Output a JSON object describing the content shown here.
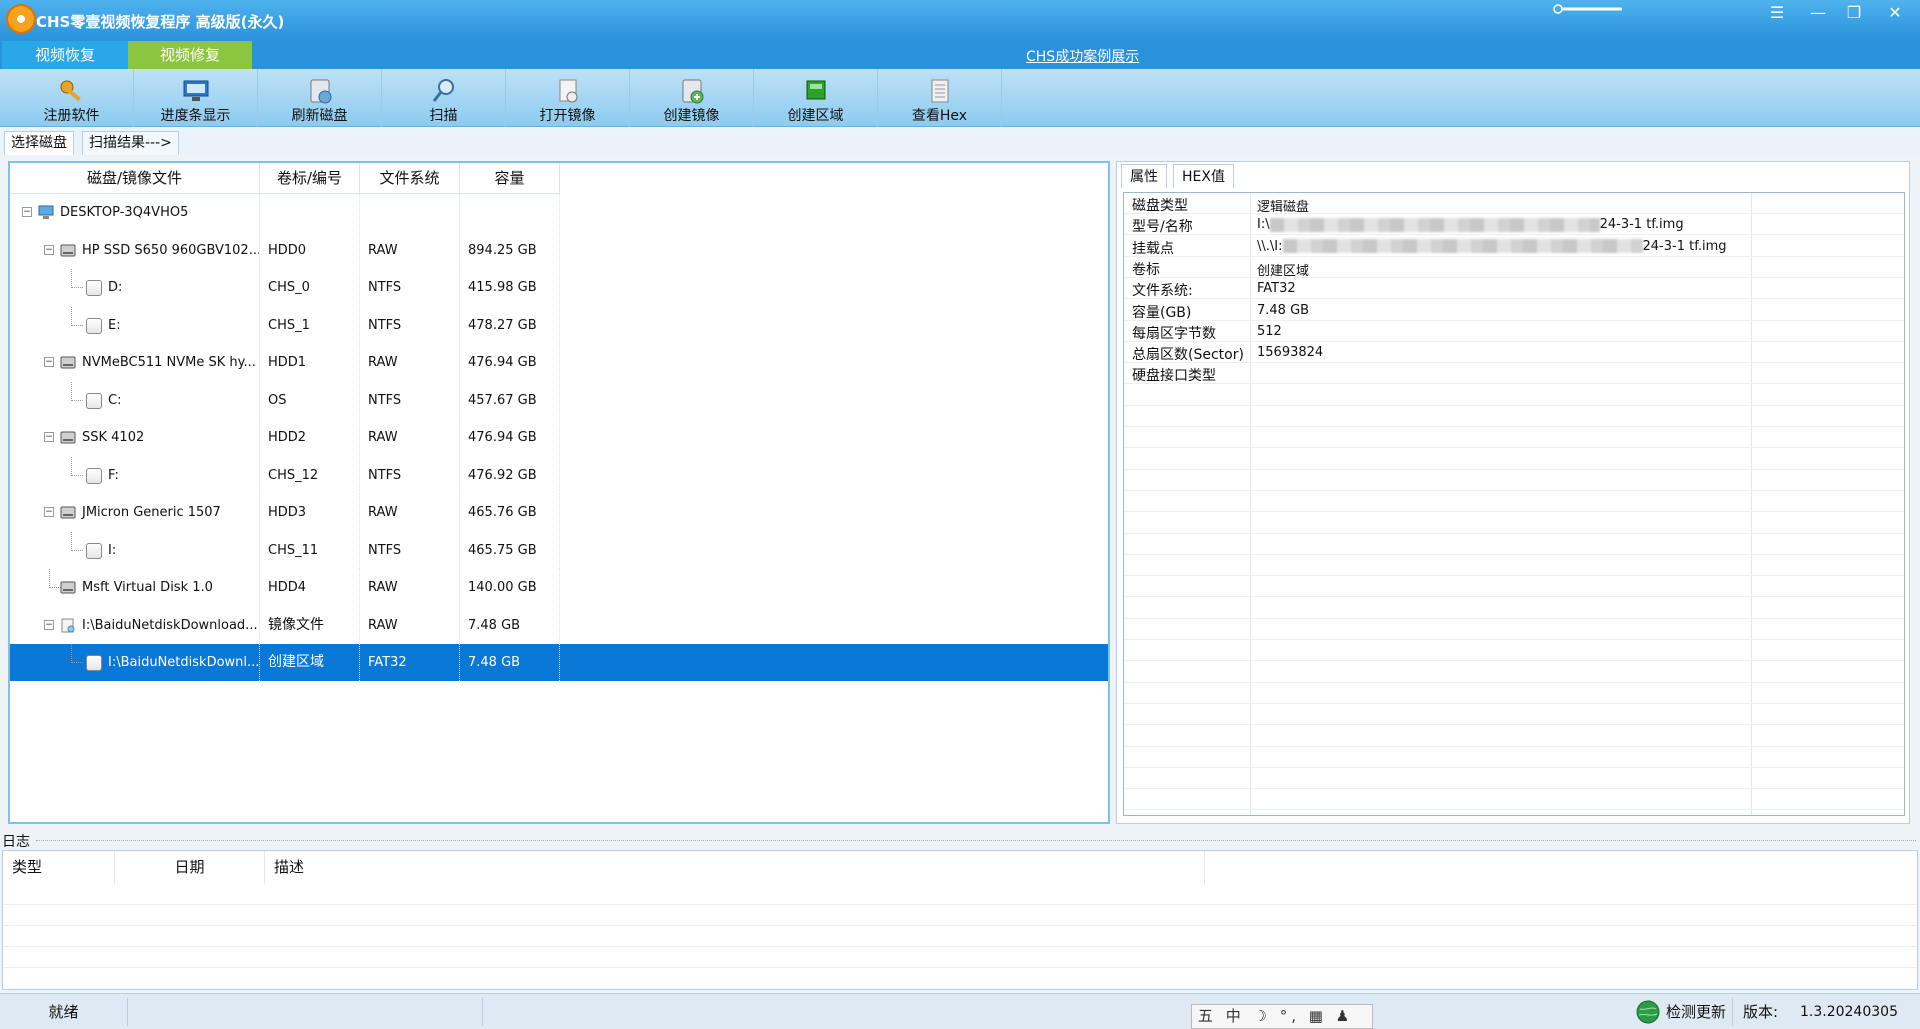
{
  "window": {
    "title": "CHS零壹视频恢复程序 高级版(永久)",
    "controls": [
      "☰",
      "—",
      "❐",
      "✕"
    ]
  },
  "mode_tabs": [
    "视频恢复",
    "视频修复"
  ],
  "success_link": "CHS成功案例展示",
  "toolbar": {
    "items": [
      {
        "label": "注册软件",
        "icon": "key-icon"
      },
      {
        "label": "进度条显示",
        "icon": "monitor-icon"
      },
      {
        "label": "刷新磁盘",
        "icon": "refresh-disk-icon"
      },
      {
        "label": "扫描",
        "icon": "magnifier-icon"
      },
      {
        "label": "打开镜像",
        "icon": "open-image-icon"
      },
      {
        "label": "创建镜像",
        "icon": "create-image-icon"
      },
      {
        "label": "创建区域",
        "icon": "create-region-icon"
      },
      {
        "label": "查看Hex",
        "icon": "hex-icon"
      }
    ]
  },
  "sub_tabs": [
    "选择磁盘",
    "扫描结果--->"
  ],
  "disk_table": {
    "headers": [
      "磁盘/镜像文件",
      "卷标/编号",
      "文件系统",
      "容量"
    ],
    "rows": [
      {
        "level": 0,
        "type": "computer",
        "name": "DESKTOP-3Q4VHO5",
        "label": "",
        "fs": "",
        "size": "",
        "expander": "−"
      },
      {
        "level": 1,
        "type": "disk",
        "name": "HP SSD S650 960GBV102...",
        "label": "HDD0",
        "fs": "RAW",
        "size": "894.25 GB",
        "expander": "−"
      },
      {
        "level": 2,
        "type": "volume",
        "name": "D:",
        "label": "CHS_0",
        "fs": "NTFS",
        "size": "415.98 GB"
      },
      {
        "level": 2,
        "type": "volume",
        "name": "E:",
        "label": "CHS_1",
        "fs": "NTFS",
        "size": "478.27 GB"
      },
      {
        "level": 1,
        "type": "disk",
        "name": "NVMeBC511 NVMe SK hy...",
        "label": "HDD1",
        "fs": "RAW",
        "size": "476.94 GB",
        "expander": "−"
      },
      {
        "level": 2,
        "type": "volume",
        "name": "C:",
        "label": "OS",
        "fs": "NTFS",
        "size": "457.67 GB"
      },
      {
        "level": 1,
        "type": "disk",
        "name": "SSK               4102",
        "label": "HDD2",
        "fs": "RAW",
        "size": "476.94 GB",
        "expander": "−"
      },
      {
        "level": 2,
        "type": "volume",
        "name": "F:",
        "label": "CHS_12",
        "fs": "NTFS",
        "size": "476.92 GB"
      },
      {
        "level": 1,
        "type": "disk",
        "name": "JMicron Generic        1507",
        "label": "HDD3",
        "fs": "RAW",
        "size": "465.76 GB",
        "expander": "−"
      },
      {
        "level": 2,
        "type": "volume",
        "name": "I:",
        "label": "CHS_11",
        "fs": "NTFS",
        "size": "465.75 GB"
      },
      {
        "level": 1,
        "type": "disk",
        "name": "Msft    Virtual Disk    1.0",
        "label": "HDD4",
        "fs": "RAW",
        "size": "140.00 GB"
      },
      {
        "level": 1,
        "type": "image",
        "name": "I:\\BaiduNetdiskDownload...",
        "label": "镜像文件",
        "fs": "RAW",
        "size": "7.48 GB",
        "expander": "−"
      },
      {
        "level": 2,
        "type": "volume",
        "name": "I:\\BaiduNetdiskDownl...",
        "label": "创建区域",
        "fs": "FAT32",
        "size": "7.48 GB",
        "selected": true
      }
    ]
  },
  "property_tabs": [
    "属性",
    "HEX值"
  ],
  "properties": [
    {
      "key": "磁盘类型",
      "value": "逻辑磁盘"
    },
    {
      "key": "型号/名称",
      "value_prefix": "I:\\",
      "value_suffix": "24-3-1 tf.img",
      "redacted": true
    },
    {
      "key": "挂载点",
      "value_prefix": "\\\\.\\I:",
      "value_suffix": "24-3-1 tf.img",
      "redacted": true
    },
    {
      "key": "卷标",
      "value": "创建区域"
    },
    {
      "key": "文件系统:",
      "value": "FAT32"
    },
    {
      "key": "容量(GB)",
      "value": "7.48 GB"
    },
    {
      "key": "每扇区字节数",
      "value": "512"
    },
    {
      "key": "总扇区数(Sector)",
      "value": "15693824"
    },
    {
      "key": "硬盘接口类型",
      "value": ""
    }
  ],
  "log": {
    "title": "日志",
    "headers": [
      "类型",
      "日期",
      "描述"
    ]
  },
  "status": {
    "state": "就绪",
    "update_label": "检测更新",
    "version_label": "版本:",
    "version": "1.3.20240305"
  },
  "ime": "五 中 ☽ °, ▦ ♟ ✎",
  "colors": {
    "title_bar": "#2a92dc",
    "mode_tab_active": "#8cc63f",
    "selection": "#0a78d7"
  }
}
